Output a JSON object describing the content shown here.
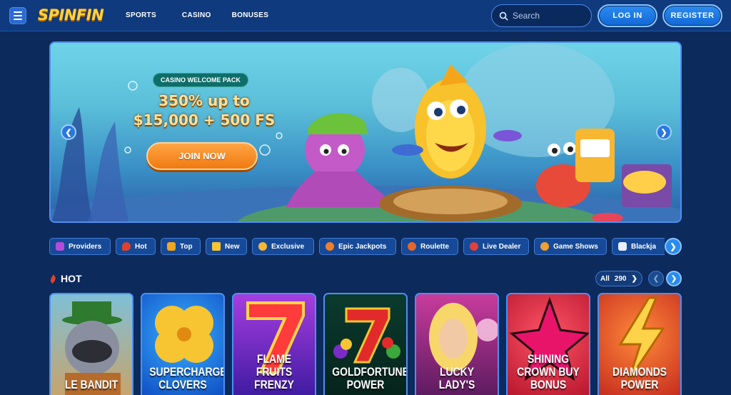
{
  "header": {
    "logo": "SPINFIN",
    "nav": [
      "SPORTS",
      "CASINO",
      "BONUSES"
    ],
    "search_placeholder": "Search",
    "login_label": "LOG IN",
    "register_label": "REGISTER"
  },
  "hero": {
    "tag": "CASINO WELCOME PACK",
    "title_line1": "350% up to",
    "title_line2": "$15,000 + 500 FS",
    "cta": "JOIN NOW",
    "prev_glyph": "❮",
    "next_glyph": "❯"
  },
  "categories": {
    "items": [
      {
        "label": "Providers",
        "icon": "providers-icon",
        "color": "#b54bd9"
      },
      {
        "label": "Hot",
        "icon": "chili-icon",
        "color": "#e0412a"
      },
      {
        "label": "Top",
        "icon": "crown-icon",
        "color": "#f2a51e"
      },
      {
        "label": "New",
        "icon": "lightning-icon",
        "color": "#f7c531"
      },
      {
        "label": "Exclusive",
        "icon": "star-burst-icon",
        "color": "#f7b731"
      },
      {
        "label": "Epic Jackpots",
        "icon": "jackpot-icon",
        "color": "#ef7f2a"
      },
      {
        "label": "Roulette",
        "icon": "roulette-icon",
        "color": "#e7662a"
      },
      {
        "label": "Live Dealer",
        "icon": "live-chip-icon",
        "color": "#e0413a"
      },
      {
        "label": "Game Shows",
        "icon": "game-show-icon",
        "color": "#f0a030"
      },
      {
        "label": "Blackja",
        "icon": "cards-icon",
        "color": "#e8eefc"
      }
    ],
    "next_glyph": "❯"
  },
  "hot": {
    "title": "HOT",
    "all_label": "All",
    "count": "290",
    "count_glyph": "❯",
    "prev_glyph": "❮",
    "next_glyph": "❯"
  },
  "games": [
    {
      "name": "LE BANDIT",
      "bg": "#5aa8c9"
    },
    {
      "name": "SUPERCHARGED CLOVERS",
      "bg": "#1570d6"
    },
    {
      "name": "FLAME FRUITS FRENZY",
      "bg": "#7b2cc7"
    },
    {
      "name": "GOLDFORTUNE POWER",
      "bg": "#0c3c2f"
    },
    {
      "name": "LUCKY LADY'S",
      "bg": "#9a2a7d"
    },
    {
      "name": "SHINING CROWN BUY BONUS",
      "bg": "#d42c3f"
    },
    {
      "name": "DIAMONDS POWER",
      "bg": "#d43e2a"
    }
  ]
}
